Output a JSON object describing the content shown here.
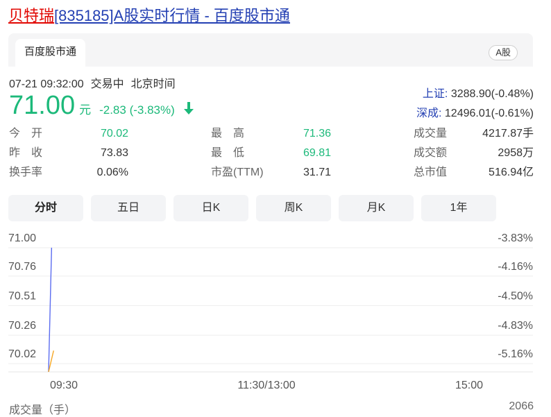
{
  "header": {
    "name": "贝特瑞",
    "rest": "[835185]A股实时行情 - 百度股市通"
  },
  "tabs": {
    "active_tab": "百度股市通",
    "market_badge": "A股"
  },
  "quote": {
    "datetime": "07-21 09:32:00",
    "status": "交易中",
    "timezone": "北京时间",
    "price": "71.00",
    "unit": "元",
    "change": "-2.83 (-3.83%)",
    "color_down": "#1cb97a"
  },
  "indices": {
    "sh_name": "上证:",
    "sh_value": "3288.90(-0.48%)",
    "sz_name": "深成:",
    "sz_value": "12496.01(-0.61%)"
  },
  "stats": {
    "open_label": "今　开",
    "open_value": "70.02",
    "prev_close_label": "昨　收",
    "prev_close_value": "73.83",
    "turnover_label": "换手率",
    "turnover_value": "0.06%",
    "high_label": "最　高",
    "high_value": "71.36",
    "low_label": "最　低",
    "low_value": "69.81",
    "pe_label": "市盈(TTM)",
    "pe_value": "31.71",
    "volume_label": "成交量",
    "volume_value": "4217.87手",
    "amount_label": "成交额",
    "amount_value": "2958万",
    "mktcap_label": "总市值",
    "mktcap_value": "516.94亿"
  },
  "period_buttons": [
    "分时",
    "五日",
    "日K",
    "周K",
    "月K",
    "1年"
  ],
  "chart_data": {
    "type": "line",
    "y_ticks": [
      "71.00",
      "70.76",
      "70.51",
      "70.26",
      "70.02"
    ],
    "y_tick_values": [
      71.0,
      70.76,
      70.51,
      70.26,
      70.02
    ],
    "right_ticks": [
      "-3.83%",
      "-4.16%",
      "-4.50%",
      "-4.83%",
      "-5.16%"
    ],
    "x_ticks": [
      "09:30",
      "11:30/13:00",
      "15:00"
    ],
    "ylim": [
      69.95,
      71.0
    ],
    "series": [
      {
        "color": "#5b6cf0",
        "points": [
          [
            0,
            69.95
          ],
          [
            0.3,
            71.0
          ]
        ]
      },
      {
        "color": "#f5a623",
        "points": [
          [
            0,
            69.95
          ],
          [
            0.5,
            70.13
          ]
        ]
      }
    ],
    "grid": true,
    "volume_label": "成交量（手）",
    "volume_max": "2066"
  }
}
